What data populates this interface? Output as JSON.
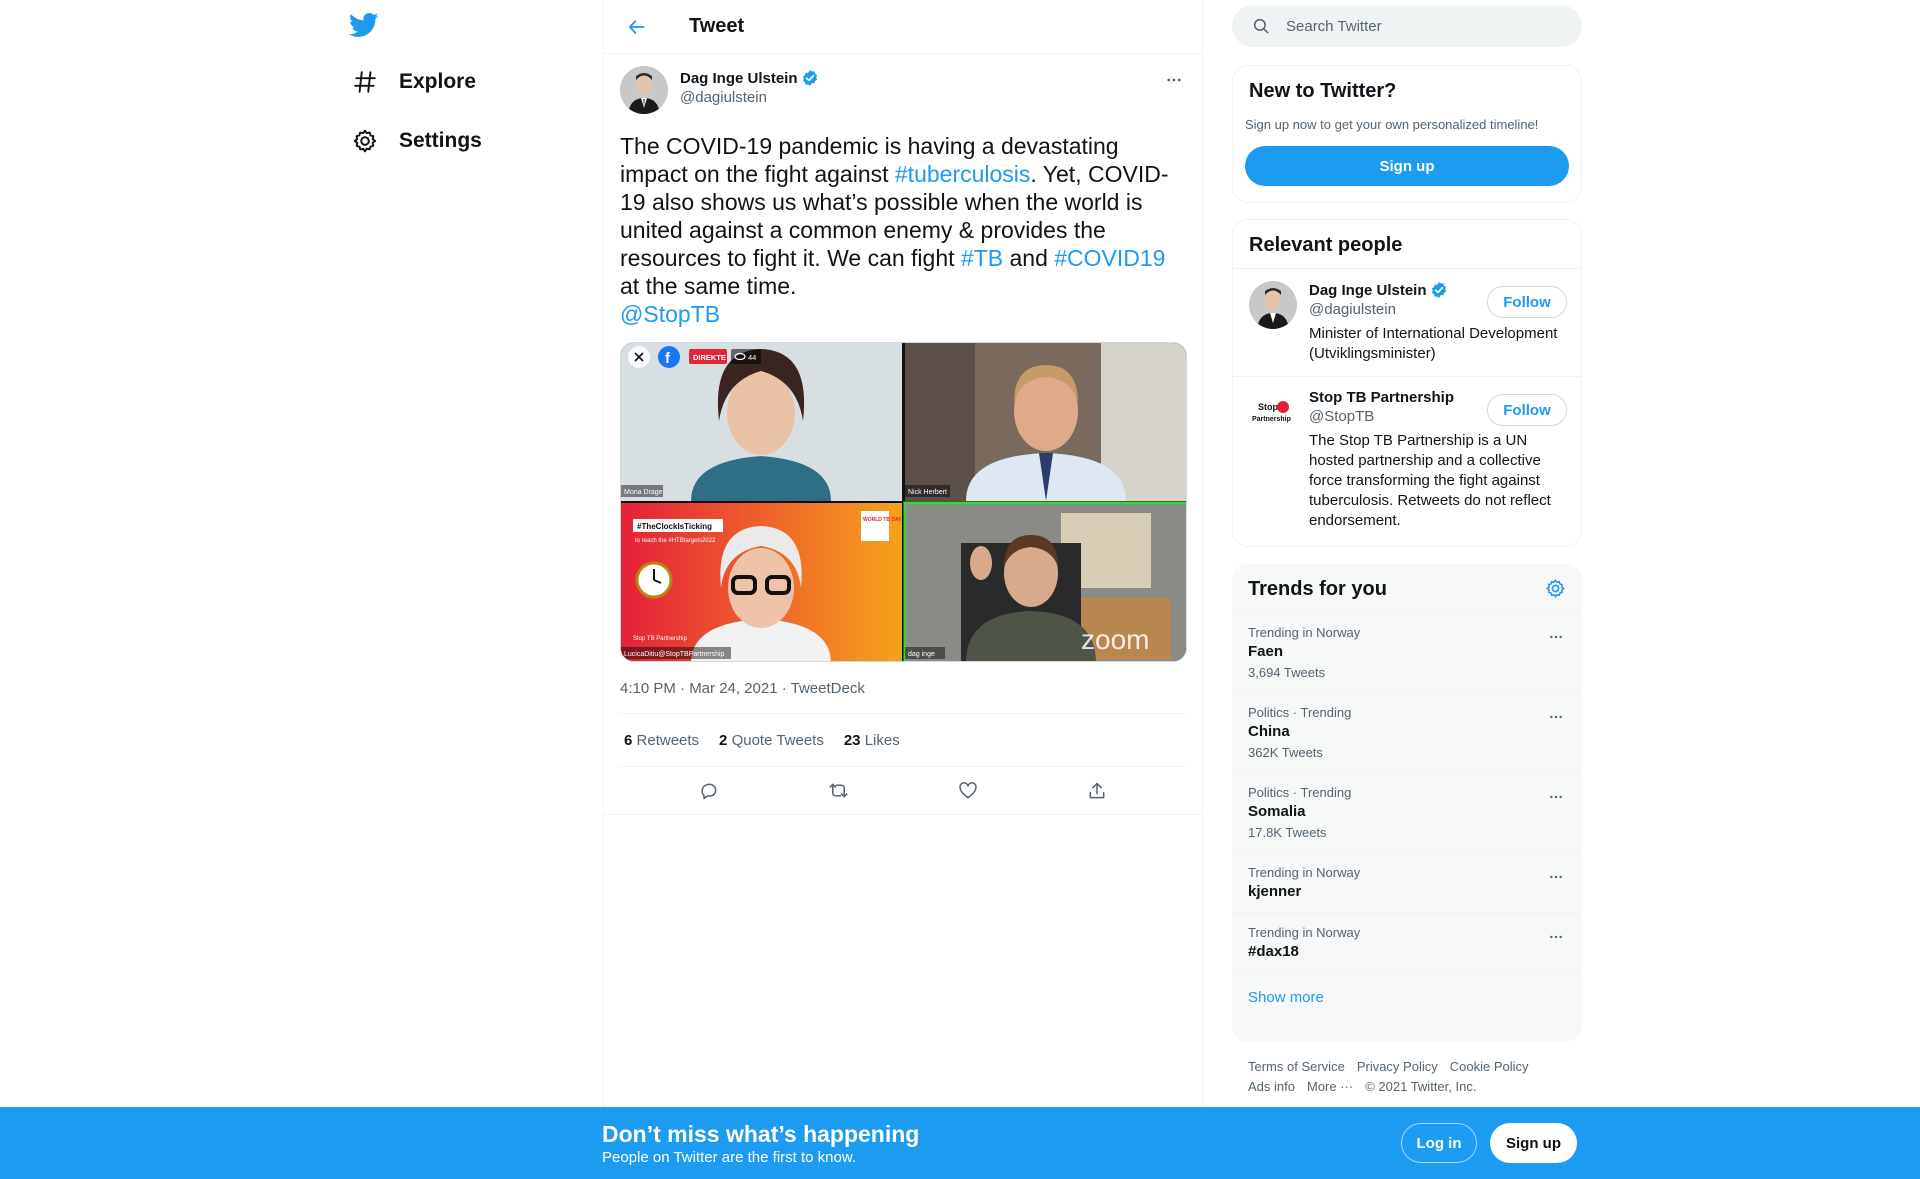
{
  "nav": {
    "explore_label": "Explore",
    "settings_label": "Settings"
  },
  "header": {
    "title": "Tweet"
  },
  "tweet": {
    "author_name": "Dag Inge Ulstein",
    "author_handle": "@dagiulstein",
    "text": {
      "p1": "The COVID-19 pandemic is having a devastating impact on the fight against ",
      "tag1": "#tuberculosis",
      "p2": ". Yet, COVID-19 also shows us what’s possible when the world is united against a common enemy & provides the resources to fight it. We can fight ",
      "tag2": "#TB",
      "p3": " and ",
      "tag3": "#COVID19",
      "p4": " at the same time.",
      "mention": "@StopTB"
    },
    "media": {
      "live_badge": "DIREKTE",
      "viewer_count": "44",
      "tiles": [
        {
          "label": "Mona Drage"
        },
        {
          "label": "Nick Herbert"
        },
        {
          "label": "LucicaDitiu@StopTBPartnership",
          "banner": "#TheClockIsTicking",
          "banner_sub": "to reach the #HTBtargets2022",
          "corner": "WORLD TB DAY",
          "partner": "Stop TB Partnership"
        },
        {
          "label": "dag inge",
          "watermark": "zoom"
        }
      ]
    },
    "meta": "4:10 PM · Mar 24, 2021 · TweetDeck",
    "stats": {
      "retweets_count": "6",
      "retweets_label": "Retweets",
      "quotes_count": "2",
      "quotes_label": "Quote Tweets",
      "likes_count": "23",
      "likes_label": "Likes"
    }
  },
  "search": {
    "placeholder": "Search Twitter"
  },
  "signup_card": {
    "title": "New to Twitter?",
    "subtitle": "Sign up now to get your own personalized timeline!",
    "button": "Sign up"
  },
  "relevant_people": {
    "title": "Relevant people",
    "people": [
      {
        "name": "Dag Inge Ulstein",
        "handle": "@dagiulstein",
        "bio": "Minister of International Development (Utviklingsminister)",
        "follow": "Follow"
      },
      {
        "name": "Stop TB Partnership",
        "handle": "@StopTB",
        "bio": "The Stop TB Partnership is a UN hosted partnership and a collective force transforming the fight against tuberculosis. Retweets do not reflect endorsement.",
        "follow": "Follow",
        "logo_line1": "Stop",
        "logo_line2": "Partnership"
      }
    ]
  },
  "trends": {
    "title": "Trends for you",
    "items": [
      {
        "context": "Trending in Norway",
        "name": "Faen",
        "count": "3,694 Tweets"
      },
      {
        "context": "Politics · Trending",
        "name": "China",
        "count": "362K Tweets"
      },
      {
        "context": "Politics · Trending",
        "name": "Somalia",
        "count": "17.8K Tweets"
      },
      {
        "context": "Trending in Norway",
        "name": "kjenner",
        "count": ""
      },
      {
        "context": "Trending in Norway",
        "name": "#dax18",
        "count": ""
      }
    ],
    "show_more": "Show more"
  },
  "footer": {
    "terms": "Terms of Service",
    "privacy": "Privacy Policy",
    "cookie": "Cookie Policy",
    "ads": "Ads info",
    "more": "More ···",
    "copyright": "© 2021 Twitter, Inc."
  },
  "bottom_bar": {
    "title": "Don’t miss what’s happening",
    "subtitle": "People on Twitter are the first to know.",
    "login": "Log in",
    "signup": "Sign up"
  },
  "colors": {
    "accent": "#1d9bf0",
    "text": "#0f1419",
    "muted": "#536471"
  }
}
